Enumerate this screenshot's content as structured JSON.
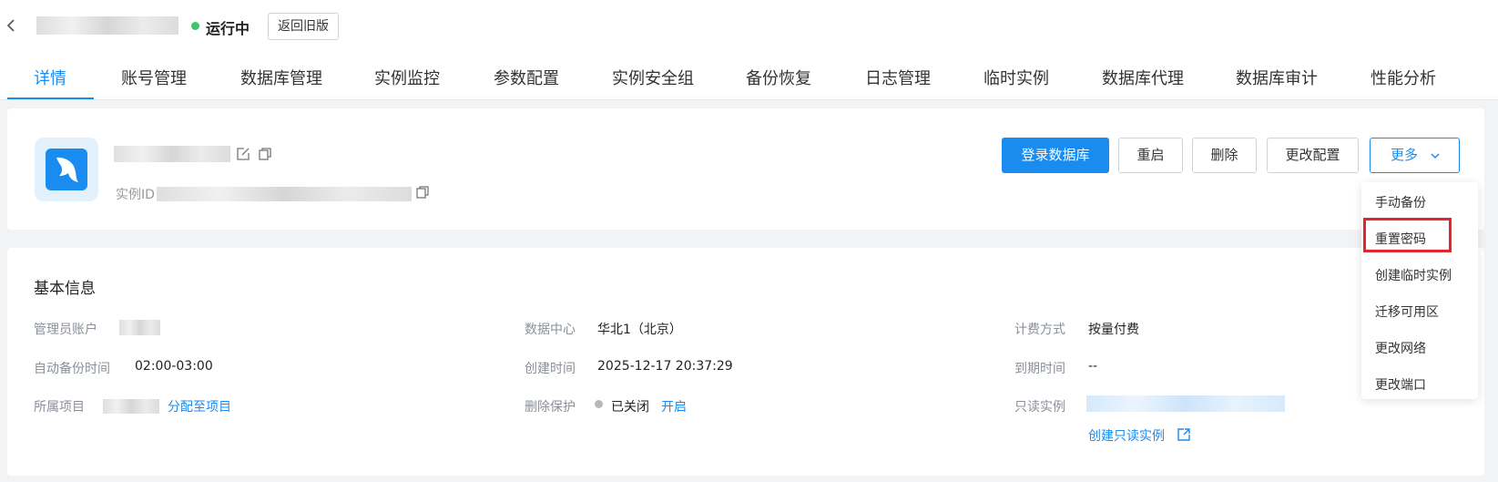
{
  "header": {
    "status": "运行中",
    "status_color": "#3ec46d",
    "back_label": "返回旧版"
  },
  "tabs": [
    {
      "label": "详情",
      "active": true
    },
    {
      "label": "账号管理"
    },
    {
      "label": "数据库管理"
    },
    {
      "label": "实例监控"
    },
    {
      "label": "参数配置"
    },
    {
      "label": "实例安全组"
    },
    {
      "label": "备份恢复"
    },
    {
      "label": "日志管理"
    },
    {
      "label": "临时实例"
    },
    {
      "label": "数据库代理"
    },
    {
      "label": "数据库审计"
    },
    {
      "label": "性能分析"
    }
  ],
  "instance": {
    "id_label": "实例ID"
  },
  "actions": {
    "login": "登录数据库",
    "restart": "重启",
    "delete": "删除",
    "modify": "更改配置",
    "more": "更多"
  },
  "more_menu": [
    "手动备份",
    "重置密码",
    "创建临时实例",
    "迁移可用区",
    "更改网络",
    "更改端口"
  ],
  "basic_info": {
    "title": "基本信息",
    "admin_account_label": "管理员账户",
    "backup_time_label": "自动备份时间",
    "backup_time_value": "02:00-03:00",
    "project_label": "所属项目",
    "assign_project_link": "分配至项目",
    "datacenter_label": "数据中心",
    "datacenter_value": "华北1（北京）",
    "created_label": "创建时间",
    "created_value": "2025-12-17 20:37:29",
    "delete_protect_label": "删除保护",
    "delete_protect_value": "已关闭",
    "enable_link": "开启",
    "billing_label": "计费方式",
    "billing_value": "按量付费",
    "expire_label": "到期时间",
    "expire_value": "--",
    "readonly_label": "只读实例",
    "create_readonly_link": "创建只读实例"
  },
  "colors": {
    "accent": "#1a8cf0",
    "highlight_border": "#e3262b"
  }
}
